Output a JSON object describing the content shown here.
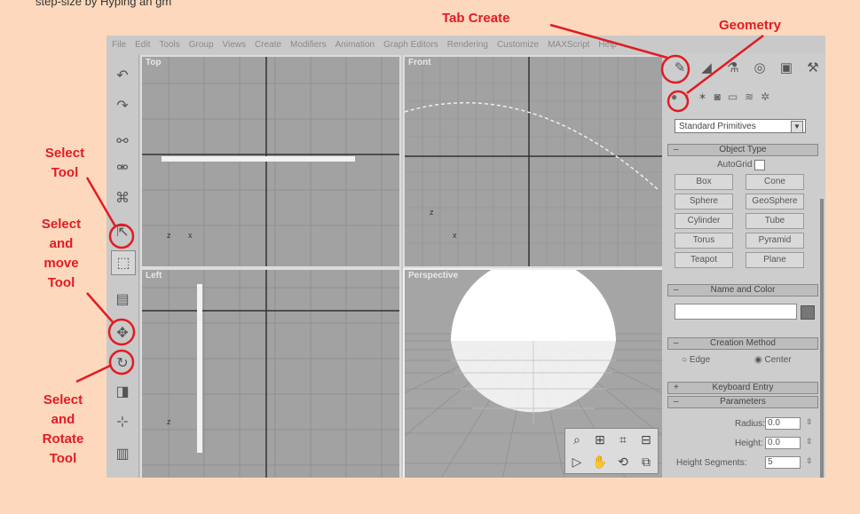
{
  "top_caption": "step-size by Hyping an gm",
  "menu": [
    "File",
    "Edit",
    "Tools",
    "Group",
    "Views",
    "Create",
    "Modifiers",
    "Animation",
    "Graph Editors",
    "Rendering",
    "Customize",
    "MAXScript",
    "Help"
  ],
  "viewports": {
    "top": "Top",
    "front": "Front",
    "left": "Left",
    "perspective": "Perspective"
  },
  "axes": {
    "z": "z",
    "x": "x"
  },
  "command_panel": {
    "category": "Standard Primitives",
    "object_type": {
      "header": "Object Type",
      "autogrid_label": "AutoGrid",
      "buttons": [
        "Box",
        "Cone",
        "Sphere",
        "GeoSphere",
        "Cylinder",
        "Tube",
        "Torus",
        "Pyramid",
        "Teapot",
        "Plane"
      ]
    },
    "name_color": {
      "header": "Name and Color",
      "name_value": ""
    },
    "creation_method": {
      "header": "Creation Method",
      "options": [
        "Edge",
        "Center"
      ],
      "selected": "Center"
    },
    "keyboard_entry": {
      "header": "Keyboard Entry"
    },
    "parameters": {
      "header": "Parameters",
      "radius_label": "Radius:",
      "radius_value": "0.0",
      "height_label": "Height:",
      "height_value": "0.0",
      "height_segments_label": "Height Segments:",
      "height_segments_value": "5"
    }
  },
  "annotations": {
    "tab_create": "Tab Create",
    "geometry": "Geometry",
    "select_tool": [
      "Select",
      "Tool"
    ],
    "select_move": [
      "Select",
      "and",
      "move",
      "Tool"
    ],
    "select_rotate": [
      "Select",
      "and",
      "Rotate",
      "Tool"
    ]
  },
  "colors": {
    "annotation": "#e21b23",
    "background": "#fdd8bd",
    "accent_active": "#ffffff"
  }
}
